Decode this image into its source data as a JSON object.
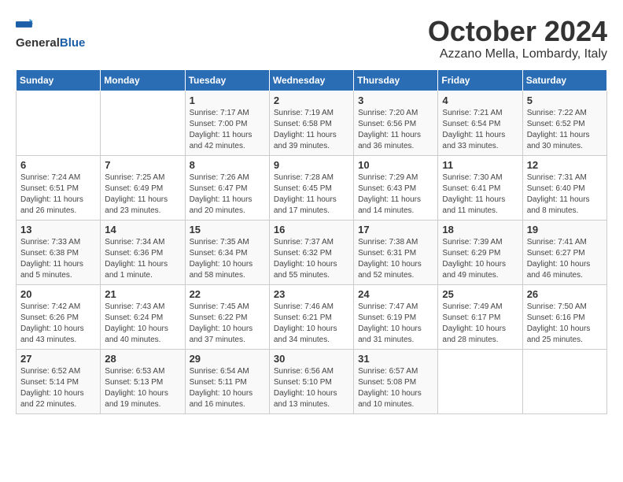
{
  "logo": {
    "general": "General",
    "blue": "Blue"
  },
  "title": "October 2024",
  "subtitle": "Azzano Mella, Lombardy, Italy",
  "headers": [
    "Sunday",
    "Monday",
    "Tuesday",
    "Wednesday",
    "Thursday",
    "Friday",
    "Saturday"
  ],
  "weeks": [
    [
      {
        "day": "",
        "info": ""
      },
      {
        "day": "",
        "info": ""
      },
      {
        "day": "1",
        "info": "Sunrise: 7:17 AM\nSunset: 7:00 PM\nDaylight: 11 hours and 42 minutes."
      },
      {
        "day": "2",
        "info": "Sunrise: 7:19 AM\nSunset: 6:58 PM\nDaylight: 11 hours and 39 minutes."
      },
      {
        "day": "3",
        "info": "Sunrise: 7:20 AM\nSunset: 6:56 PM\nDaylight: 11 hours and 36 minutes."
      },
      {
        "day": "4",
        "info": "Sunrise: 7:21 AM\nSunset: 6:54 PM\nDaylight: 11 hours and 33 minutes."
      },
      {
        "day": "5",
        "info": "Sunrise: 7:22 AM\nSunset: 6:52 PM\nDaylight: 11 hours and 30 minutes."
      }
    ],
    [
      {
        "day": "6",
        "info": "Sunrise: 7:24 AM\nSunset: 6:51 PM\nDaylight: 11 hours and 26 minutes."
      },
      {
        "day": "7",
        "info": "Sunrise: 7:25 AM\nSunset: 6:49 PM\nDaylight: 11 hours and 23 minutes."
      },
      {
        "day": "8",
        "info": "Sunrise: 7:26 AM\nSunset: 6:47 PM\nDaylight: 11 hours and 20 minutes."
      },
      {
        "day": "9",
        "info": "Sunrise: 7:28 AM\nSunset: 6:45 PM\nDaylight: 11 hours and 17 minutes."
      },
      {
        "day": "10",
        "info": "Sunrise: 7:29 AM\nSunset: 6:43 PM\nDaylight: 11 hours and 14 minutes."
      },
      {
        "day": "11",
        "info": "Sunrise: 7:30 AM\nSunset: 6:41 PM\nDaylight: 11 hours and 11 minutes."
      },
      {
        "day": "12",
        "info": "Sunrise: 7:31 AM\nSunset: 6:40 PM\nDaylight: 11 hours and 8 minutes."
      }
    ],
    [
      {
        "day": "13",
        "info": "Sunrise: 7:33 AM\nSunset: 6:38 PM\nDaylight: 11 hours and 5 minutes."
      },
      {
        "day": "14",
        "info": "Sunrise: 7:34 AM\nSunset: 6:36 PM\nDaylight: 11 hours and 1 minute."
      },
      {
        "day": "15",
        "info": "Sunrise: 7:35 AM\nSunset: 6:34 PM\nDaylight: 10 hours and 58 minutes."
      },
      {
        "day": "16",
        "info": "Sunrise: 7:37 AM\nSunset: 6:32 PM\nDaylight: 10 hours and 55 minutes."
      },
      {
        "day": "17",
        "info": "Sunrise: 7:38 AM\nSunset: 6:31 PM\nDaylight: 10 hours and 52 minutes."
      },
      {
        "day": "18",
        "info": "Sunrise: 7:39 AM\nSunset: 6:29 PM\nDaylight: 10 hours and 49 minutes."
      },
      {
        "day": "19",
        "info": "Sunrise: 7:41 AM\nSunset: 6:27 PM\nDaylight: 10 hours and 46 minutes."
      }
    ],
    [
      {
        "day": "20",
        "info": "Sunrise: 7:42 AM\nSunset: 6:26 PM\nDaylight: 10 hours and 43 minutes."
      },
      {
        "day": "21",
        "info": "Sunrise: 7:43 AM\nSunset: 6:24 PM\nDaylight: 10 hours and 40 minutes."
      },
      {
        "day": "22",
        "info": "Sunrise: 7:45 AM\nSunset: 6:22 PM\nDaylight: 10 hours and 37 minutes."
      },
      {
        "day": "23",
        "info": "Sunrise: 7:46 AM\nSunset: 6:21 PM\nDaylight: 10 hours and 34 minutes."
      },
      {
        "day": "24",
        "info": "Sunrise: 7:47 AM\nSunset: 6:19 PM\nDaylight: 10 hours and 31 minutes."
      },
      {
        "day": "25",
        "info": "Sunrise: 7:49 AM\nSunset: 6:17 PM\nDaylight: 10 hours and 28 minutes."
      },
      {
        "day": "26",
        "info": "Sunrise: 7:50 AM\nSunset: 6:16 PM\nDaylight: 10 hours and 25 minutes."
      }
    ],
    [
      {
        "day": "27",
        "info": "Sunrise: 6:52 AM\nSunset: 5:14 PM\nDaylight: 10 hours and 22 minutes."
      },
      {
        "day": "28",
        "info": "Sunrise: 6:53 AM\nSunset: 5:13 PM\nDaylight: 10 hours and 19 minutes."
      },
      {
        "day": "29",
        "info": "Sunrise: 6:54 AM\nSunset: 5:11 PM\nDaylight: 10 hours and 16 minutes."
      },
      {
        "day": "30",
        "info": "Sunrise: 6:56 AM\nSunset: 5:10 PM\nDaylight: 10 hours and 13 minutes."
      },
      {
        "day": "31",
        "info": "Sunrise: 6:57 AM\nSunset: 5:08 PM\nDaylight: 10 hours and 10 minutes."
      },
      {
        "day": "",
        "info": ""
      },
      {
        "day": "",
        "info": ""
      }
    ]
  ]
}
